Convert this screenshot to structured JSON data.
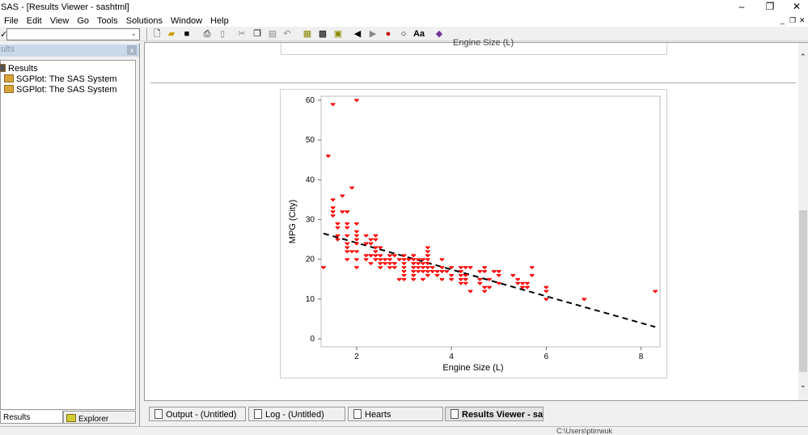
{
  "window": {
    "title": "SAS - [Results Viewer - sashtml]",
    "minimize": "–",
    "restore": "❐",
    "close": "✕",
    "mdi_min": "_",
    "mdi_restore": "❐",
    "mdi_close": "✕"
  },
  "menu": [
    "File",
    "Edit",
    "View",
    "Go",
    "Tools",
    "Solutions",
    "Window",
    "Help"
  ],
  "command_box": {
    "value": "",
    "check": "✓"
  },
  "toolbar_icons": [
    "new-icon",
    "open-icon",
    "save-icon",
    "print-icon",
    "print-preview-icon",
    "cut-icon",
    "copy-icon",
    "paste-icon",
    "undo-icon",
    "libraries-icon",
    "explorer-icon",
    "results-icon",
    "back-icon",
    "forward-icon",
    "stop-icon",
    "refresh-icon",
    "font-icon",
    "help-icon"
  ],
  "left_panel": {
    "title": "ults",
    "close": "x",
    "tree": [
      {
        "label": "Results"
      },
      {
        "label": "SGPlot:  The SAS System"
      },
      {
        "label": "SGPlot:  The SAS System"
      }
    ],
    "tabs": [
      "Results",
      "Explorer"
    ]
  },
  "prev_plot_xlabel": "Engine Size (L)",
  "taskbar": [
    {
      "label": "Output - (Untitled)"
    },
    {
      "label": "Log - (Untitled)"
    },
    {
      "label": "Hearts"
    },
    {
      "label": "Results Viewer - sasht..."
    }
  ],
  "status": {
    "path": "C:\\Users\\ptirrwuk"
  },
  "colors": {
    "marker": "#ff0000",
    "line": "#000000"
  },
  "chart_data": {
    "type": "scatter",
    "xlabel": "Engine Size (L)",
    "ylabel": "MPG (City)",
    "xlim": [
      1.25,
      8.4
    ],
    "ylim": [
      -2,
      61
    ],
    "xticks": [
      2,
      4,
      6,
      8
    ],
    "yticks": [
      0,
      10,
      20,
      30,
      40,
      50,
      60
    ],
    "marker": "heart",
    "regression": {
      "style": "dashed",
      "x": [
        1.3,
        8.3
      ],
      "y": [
        26.5,
        3.0
      ]
    },
    "points": [
      [
        1.3,
        18
      ],
      [
        1.4,
        46
      ],
      [
        1.5,
        59
      ],
      [
        2.0,
        60
      ],
      [
        1.5,
        35
      ],
      [
        1.5,
        33
      ],
      [
        1.5,
        32
      ],
      [
        1.5,
        31
      ],
      [
        1.7,
        32
      ],
      [
        1.8,
        32
      ],
      [
        1.6,
        29
      ],
      [
        1.6,
        28
      ],
      [
        1.6,
        26
      ],
      [
        1.6,
        25
      ],
      [
        1.8,
        29
      ],
      [
        1.8,
        28
      ],
      [
        1.8,
        26
      ],
      [
        1.8,
        24
      ],
      [
        1.8,
        23
      ],
      [
        1.8,
        22
      ],
      [
        1.8,
        20
      ],
      [
        1.9,
        22
      ],
      [
        2.0,
        29
      ],
      [
        2.0,
        27
      ],
      [
        2.0,
        26
      ],
      [
        2.0,
        25
      ],
      [
        2.0,
        24
      ],
      [
        2.0,
        22
      ],
      [
        2.0,
        20
      ],
      [
        2.0,
        18
      ],
      [
        1.9,
        38
      ],
      [
        1.7,
        36
      ],
      [
        2.2,
        26
      ],
      [
        2.2,
        24
      ],
      [
        2.2,
        21
      ],
      [
        2.2,
        20
      ],
      [
        2.3,
        25
      ],
      [
        2.3,
        24
      ],
      [
        2.3,
        21
      ],
      [
        2.3,
        19
      ],
      [
        2.4,
        26
      ],
      [
        2.4,
        25
      ],
      [
        2.4,
        23
      ],
      [
        2.4,
        22
      ],
      [
        2.4,
        21
      ],
      [
        2.4,
        20
      ],
      [
        2.5,
        23
      ],
      [
        2.5,
        21
      ],
      [
        2.5,
        20
      ],
      [
        2.5,
        19
      ],
      [
        2.5,
        18
      ],
      [
        2.6,
        20
      ],
      [
        2.6,
        19
      ],
      [
        2.7,
        21
      ],
      [
        2.7,
        20
      ],
      [
        2.7,
        19
      ],
      [
        2.7,
        18
      ],
      [
        2.8,
        21
      ],
      [
        2.8,
        19
      ],
      [
        2.8,
        18
      ],
      [
        2.9,
        20
      ],
      [
        3.0,
        21
      ],
      [
        3.0,
        20
      ],
      [
        3.0,
        19
      ],
      [
        3.0,
        18
      ],
      [
        3.0,
        17
      ],
      [
        3.0,
        16
      ],
      [
        3.0,
        15
      ],
      [
        2.9,
        15
      ],
      [
        3.2,
        21
      ],
      [
        3.2,
        20
      ],
      [
        3.1,
        20
      ],
      [
        3.2,
        19
      ],
      [
        3.2,
        18
      ],
      [
        3.2,
        17
      ],
      [
        3.2,
        16
      ],
      [
        3.2,
        15
      ],
      [
        3.3,
        20
      ],
      [
        3.3,
        19
      ],
      [
        3.3,
        18
      ],
      [
        3.3,
        17
      ],
      [
        3.4,
        20
      ],
      [
        3.4,
        19
      ],
      [
        3.4,
        18
      ],
      [
        3.4,
        17
      ],
      [
        3.5,
        23
      ],
      [
        3.5,
        22
      ],
      [
        3.5,
        21
      ],
      [
        3.5,
        20
      ],
      [
        3.5,
        19
      ],
      [
        3.5,
        18
      ],
      [
        3.5,
        17
      ],
      [
        3.5,
        16
      ],
      [
        3.4,
        15
      ],
      [
        3.6,
        18
      ],
      [
        3.6,
        17
      ],
      [
        3.7,
        17
      ],
      [
        3.7,
        16
      ],
      [
        3.8,
        20
      ],
      [
        3.8,
        18
      ],
      [
        3.8,
        17
      ],
      [
        3.8,
        15
      ],
      [
        3.9,
        17
      ],
      [
        4.0,
        18
      ],
      [
        4.0,
        16
      ],
      [
        4.0,
        15
      ],
      [
        4.2,
        18
      ],
      [
        4.2,
        17
      ],
      [
        4.2,
        16
      ],
      [
        4.2,
        15
      ],
      [
        4.2,
        14
      ],
      [
        4.3,
        18
      ],
      [
        4.3,
        16
      ],
      [
        4.3,
        15
      ],
      [
        4.3,
        14
      ],
      [
        4.4,
        18
      ],
      [
        4.4,
        12
      ],
      [
        4.6,
        17
      ],
      [
        4.6,
        15
      ],
      [
        4.6,
        14
      ],
      [
        4.7,
        18
      ],
      [
        4.7,
        17
      ],
      [
        4.7,
        13
      ],
      [
        4.7,
        12
      ],
      [
        4.8,
        15
      ],
      [
        4.8,
        13
      ],
      [
        4.9,
        17
      ],
      [
        5.0,
        17
      ],
      [
        5.0,
        16
      ],
      [
        5.0,
        14
      ],
      [
        5.3,
        16
      ],
      [
        5.4,
        15
      ],
      [
        5.4,
        14
      ],
      [
        5.5,
        14
      ],
      [
        5.5,
        13
      ],
      [
        5.6,
        14
      ],
      [
        5.6,
        13
      ],
      [
        5.7,
        18
      ],
      [
        5.7,
        16
      ],
      [
        6.0,
        13
      ],
      [
        6.0,
        12
      ],
      [
        6.0,
        10
      ],
      [
        6.8,
        10
      ],
      [
        8.3,
        12
      ]
    ]
  }
}
